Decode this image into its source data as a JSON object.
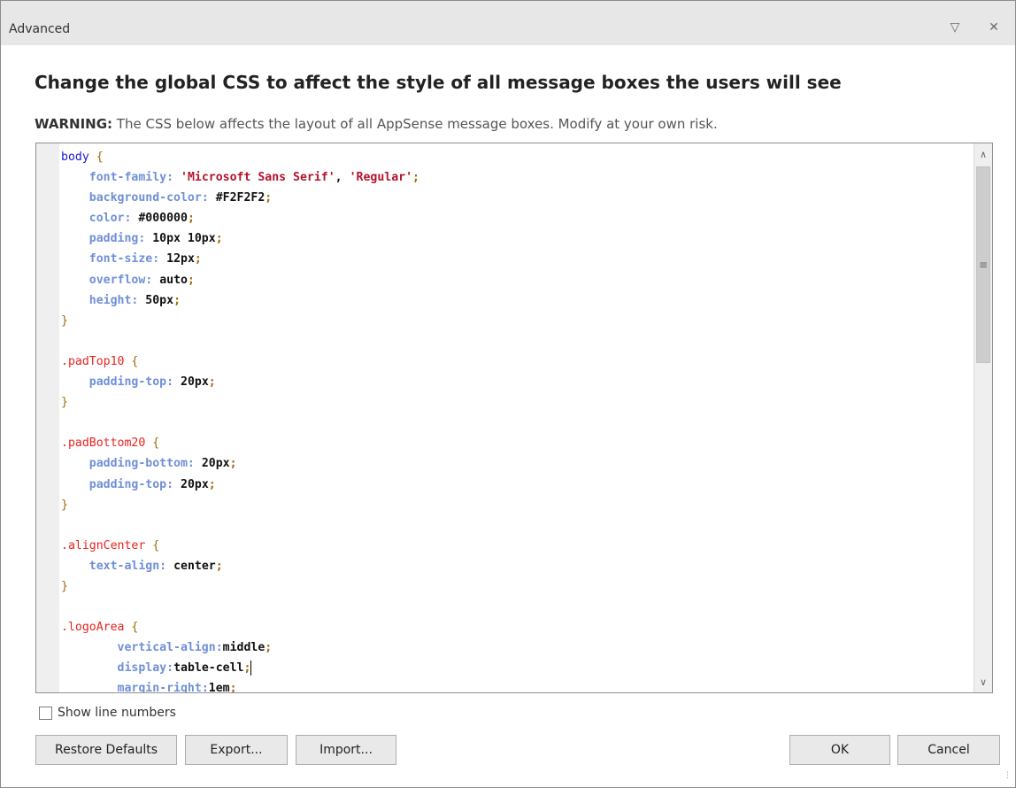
{
  "window": {
    "title": "Advanced",
    "pin_glyph": "▽",
    "close_glyph": "✕"
  },
  "heading": "Change the global CSS to affect the style of all message boxes the users will see",
  "warning": {
    "label": "WARNING:",
    "text": " The CSS below affects the layout of all AppSense message boxes. Modify at your own risk."
  },
  "editor": {
    "lines": [
      [
        [
          "kw-body",
          "body"
        ],
        [
          "brace",
          " {"
        ]
      ],
      [
        [
          "plain",
          "    "
        ],
        [
          "prop",
          "font-family"
        ],
        [
          "prop",
          ": "
        ],
        [
          "str",
          "'Microsoft Sans Serif'"
        ],
        [
          "val",
          ", "
        ],
        [
          "str",
          "'Regular'"
        ],
        [
          "semi",
          ";"
        ]
      ],
      [
        [
          "plain",
          "    "
        ],
        [
          "prop",
          "background-color"
        ],
        [
          "prop",
          ": "
        ],
        [
          "val",
          "#F2F2F2"
        ],
        [
          "semi",
          ";"
        ]
      ],
      [
        [
          "plain",
          "    "
        ],
        [
          "prop",
          "color"
        ],
        [
          "prop",
          ": "
        ],
        [
          "val",
          "#000000"
        ],
        [
          "semi",
          ";"
        ]
      ],
      [
        [
          "plain",
          "    "
        ],
        [
          "prop",
          "padding"
        ],
        [
          "prop",
          ": "
        ],
        [
          "val",
          "10px 10px"
        ],
        [
          "semi",
          ";"
        ]
      ],
      [
        [
          "plain",
          "    "
        ],
        [
          "prop",
          "font-size"
        ],
        [
          "prop",
          ": "
        ],
        [
          "val",
          "12px"
        ],
        [
          "semi",
          ";"
        ]
      ],
      [
        [
          "plain",
          "    "
        ],
        [
          "prop",
          "overflow"
        ],
        [
          "prop",
          ": "
        ],
        [
          "val",
          "auto"
        ],
        [
          "semi",
          ";"
        ]
      ],
      [
        [
          "plain",
          "    "
        ],
        [
          "prop",
          "height"
        ],
        [
          "prop",
          ": "
        ],
        [
          "val",
          "50px"
        ],
        [
          "semi",
          ";"
        ]
      ],
      [
        [
          "brace",
          "}"
        ]
      ],
      [
        [
          "plain",
          ""
        ]
      ],
      [
        [
          "sel",
          ".padTop10"
        ],
        [
          "brace",
          " {"
        ]
      ],
      [
        [
          "plain",
          "    "
        ],
        [
          "prop",
          "padding-top"
        ],
        [
          "prop",
          ": "
        ],
        [
          "val",
          "20px"
        ],
        [
          "semi",
          ";"
        ]
      ],
      [
        [
          "brace",
          "}"
        ]
      ],
      [
        [
          "plain",
          ""
        ]
      ],
      [
        [
          "sel",
          ".padBottom20"
        ],
        [
          "brace",
          " {"
        ]
      ],
      [
        [
          "plain",
          "    "
        ],
        [
          "prop",
          "padding-bottom"
        ],
        [
          "prop",
          ": "
        ],
        [
          "val",
          "20px"
        ],
        [
          "semi",
          ";"
        ]
      ],
      [
        [
          "plain",
          "    "
        ],
        [
          "prop",
          "padding-top"
        ],
        [
          "prop",
          ": "
        ],
        [
          "val",
          "20px"
        ],
        [
          "semi",
          ";"
        ]
      ],
      [
        [
          "brace",
          "}"
        ]
      ],
      [
        [
          "plain",
          ""
        ]
      ],
      [
        [
          "sel",
          ".alignCenter"
        ],
        [
          "brace",
          " {"
        ]
      ],
      [
        [
          "plain",
          "    "
        ],
        [
          "prop",
          "text-align"
        ],
        [
          "prop",
          ": "
        ],
        [
          "val",
          "center"
        ],
        [
          "semi",
          ";"
        ]
      ],
      [
        [
          "brace",
          "}"
        ]
      ],
      [
        [
          "plain",
          ""
        ]
      ],
      [
        [
          "sel",
          ".logoArea"
        ],
        [
          "brace",
          " {"
        ]
      ],
      [
        [
          "plain",
          "        "
        ],
        [
          "prop",
          "vertical-align"
        ],
        [
          "prop",
          ":"
        ],
        [
          "val",
          "middle"
        ],
        [
          "semi",
          ";"
        ]
      ],
      [
        [
          "plain",
          "        "
        ],
        [
          "prop",
          "display"
        ],
        [
          "prop",
          ":"
        ],
        [
          "val",
          "table-cell"
        ],
        [
          "semi",
          ";"
        ],
        [
          "cursor",
          ""
        ]
      ],
      [
        [
          "plain",
          "        "
        ],
        [
          "prop",
          "margin-right"
        ],
        [
          "prop",
          ":"
        ],
        [
          "val",
          "1em"
        ],
        [
          "semi",
          ";"
        ]
      ]
    ]
  },
  "scrollbar": {
    "up_glyph": "∧",
    "down_glyph": "∨",
    "thumb_glyph": "≡"
  },
  "show_line_numbers": {
    "label": "Show line numbers",
    "checked": false
  },
  "buttons": {
    "restore": "Restore Defaults",
    "export": "Export...",
    "import": "Import...",
    "ok": "OK",
    "cancel": "Cancel"
  },
  "icons": {
    "pin": "pin-icon",
    "close": "close-icon",
    "resize": "resize-grip-icon"
  }
}
